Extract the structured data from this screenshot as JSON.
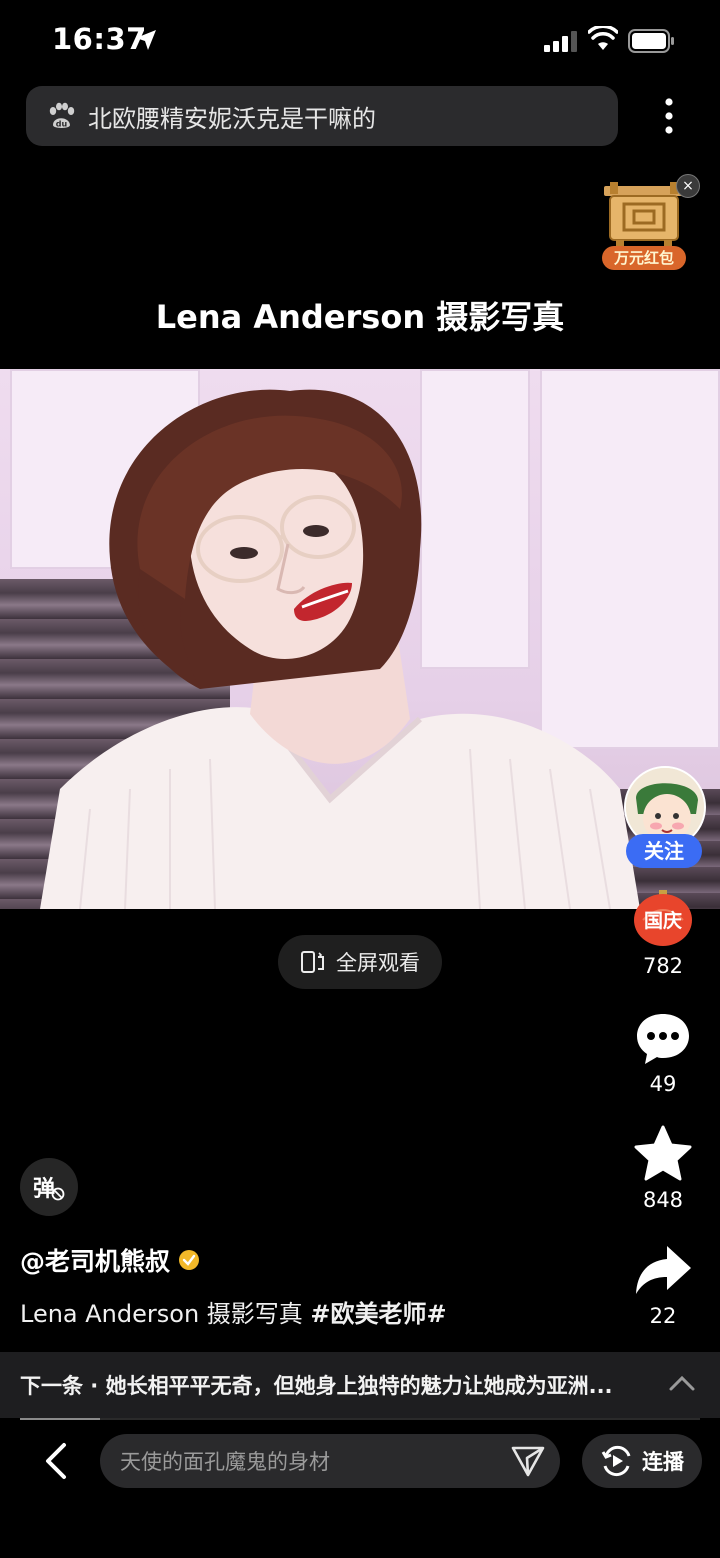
{
  "status_bar": {
    "time": "16:37"
  },
  "search": {
    "query": "北欧腰精安妮沃克是干嘛的"
  },
  "promo": {
    "label": "万元红包",
    "close": "×"
  },
  "video": {
    "title": "Lena Anderson 摄影写真",
    "fullscreen_label": "全屏观看"
  },
  "rail": {
    "follow_label": "关注",
    "festival_badge": "国庆",
    "like_count": "782",
    "comment_count": "49",
    "favorite_count": "848",
    "share_count": "22"
  },
  "danmu_label": "弹",
  "author": {
    "name": "@老司机熊叔"
  },
  "description": {
    "text": "Lena Anderson 摄影写真 ",
    "hashtag": "#欧美老师#"
  },
  "next": {
    "text": "下一条 · 她长相平平无奇，但她身上独特的魅力让她成为亚洲..."
  },
  "bottom": {
    "comment_placeholder": "天使的面孔魔鬼的身材",
    "autoplay_label": "连播"
  },
  "colors": {
    "accent_blue": "#3b6cf4",
    "festival_red": "#e8452c",
    "verify_gold": "#f2b829"
  }
}
